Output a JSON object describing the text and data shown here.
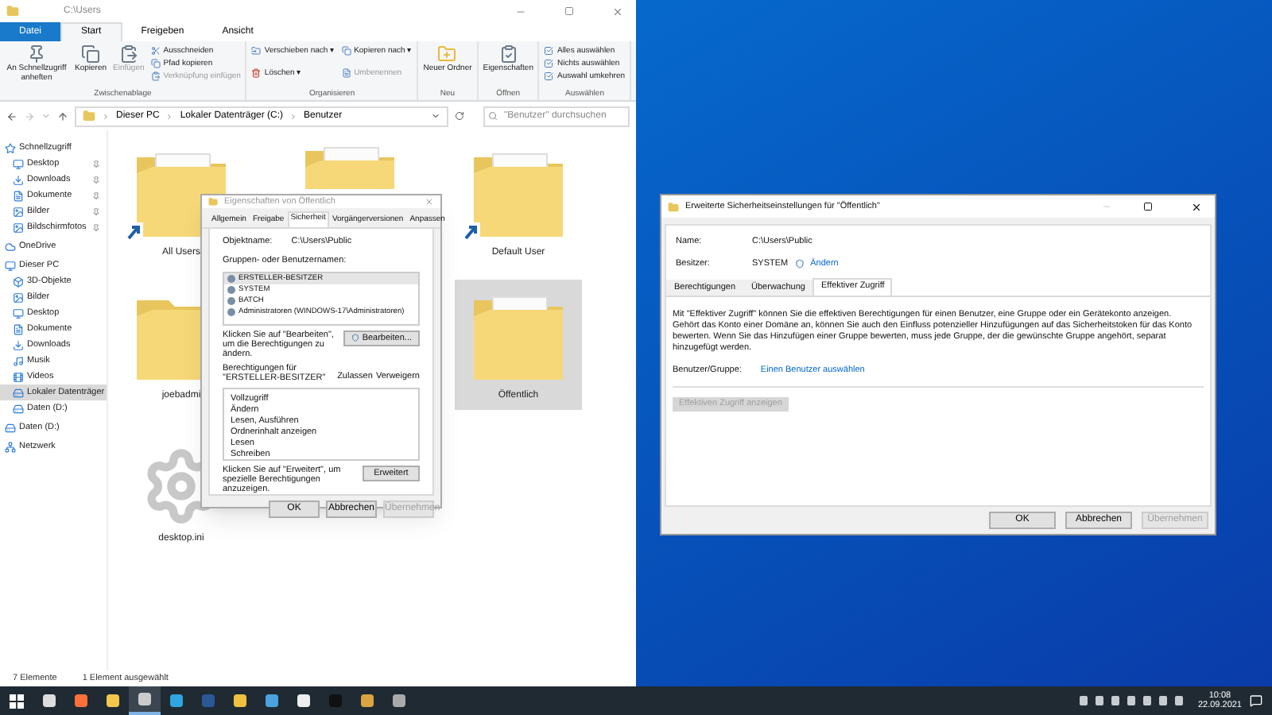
{
  "explorer": {
    "title": "C:\\Users",
    "ribbon_tabs": [
      {
        "label": "Datei",
        "kind": "file"
      },
      {
        "label": "Start",
        "selected": true
      },
      {
        "label": "Freigeben",
        "selected": false
      },
      {
        "label": "Ansicht",
        "selected": false
      }
    ],
    "ribbon_groups": [
      {
        "label": "Zwischenablage",
        "large": [
          {
            "label": "An Schnellzugriff anheften",
            "disabled": false
          },
          {
            "label": "Kopieren",
            "disabled": false
          },
          {
            "label": "Einfügen",
            "disabled": true
          }
        ],
        "small": [
          {
            "label": "Ausschneiden",
            "disabled": false
          },
          {
            "label": "Pfad kopieren",
            "disabled": false
          },
          {
            "label": "Verknüpfung einfügen",
            "disabled": true
          }
        ]
      },
      {
        "label": "Organisieren",
        "small": [
          {
            "label": "Verschieben nach ▾",
            "disabled": false
          },
          {
            "label": "Kopieren nach ▾",
            "disabled": false
          },
          {
            "label": "Löschen ▾",
            "disabled": false
          },
          {
            "label": "Umbenennen",
            "disabled": true
          }
        ]
      },
      {
        "label": "Neu",
        "large": [
          {
            "label": "Neuer Ordner",
            "disabled": false
          }
        ]
      },
      {
        "label": "Öffnen",
        "large": [
          {
            "label": "Eigenschaften",
            "disabled": false
          }
        ]
      },
      {
        "label": "Auswählen",
        "small": [
          {
            "label": "Alles auswählen",
            "disabled": false
          },
          {
            "label": "Nichts auswählen",
            "disabled": false
          },
          {
            "label": "Auswahl umkehren",
            "disabled": false
          }
        ]
      }
    ],
    "breadcrumb": [
      "Dieser PC",
      "Lokaler Datenträger (C:)",
      "Benutzer"
    ],
    "search": {
      "placeholder": "\"Benutzer\" durchsuchen"
    },
    "nav": [
      {
        "label": "Schnellzugriff",
        "selected": false,
        "children": [
          {
            "label": "Desktop",
            "selected": false,
            "pinned": true
          },
          {
            "label": "Downloads",
            "selected": false,
            "pinned": true
          },
          {
            "label": "Dokumente",
            "selected": false,
            "pinned": true
          },
          {
            "label": "Bilder",
            "selected": false,
            "pinned": true
          },
          {
            "label": "Bildschirmfotos",
            "selected": false,
            "pinned": true
          }
        ]
      },
      {
        "label": "OneDrive",
        "selected": false
      },
      {
        "label": "Dieser PC",
        "selected": false,
        "children": [
          {
            "label": "3D-Objekte",
            "selected": false
          },
          {
            "label": "Bilder",
            "selected": false
          },
          {
            "label": "Desktop",
            "selected": false
          },
          {
            "label": "Dokumente",
            "selected": false
          },
          {
            "label": "Downloads",
            "selected": false
          },
          {
            "label": "Musik",
            "selected": false
          },
          {
            "label": "Videos",
            "selected": false
          },
          {
            "label": "Lokaler Datenträger",
            "selected": true
          },
          {
            "label": "Daten (D:)",
            "selected": false
          }
        ]
      },
      {
        "label": "Daten (D:)",
        "selected": false
      },
      {
        "label": "Netzwerk",
        "selected": false
      }
    ],
    "file_columns": [
      [
        {
          "label": "All Users",
          "kind": "shortcut",
          "selected": false
        },
        {
          "label": "joebadmi",
          "kind": "folder",
          "selected": false
        },
        {
          "label": "desktop.ini",
          "kind": "settings-file",
          "selected": false
        }
      ],
      [
        {
          "kind": "document-folder",
          "selected": false
        }
      ],
      [
        {
          "label": "Default User",
          "kind": "shortcut",
          "selected": false
        },
        {
          "label": "Öffentlich",
          "kind": "document-folder",
          "selected": true
        }
      ]
    ],
    "status": [
      "7 Elemente",
      "1 Element ausgewählt"
    ]
  },
  "properties": {
    "title": "Eigenschaften von Öffentlich",
    "tabs": [
      {
        "label": "Allgemein",
        "selected": false
      },
      {
        "label": "Freigabe",
        "selected": false
      },
      {
        "label": "Sicherheit",
        "selected": true
      },
      {
        "label": "Vorgängerversionen",
        "selected": false
      },
      {
        "label": "Anpassen",
        "selected": false
      }
    ],
    "object_label": "Objektname:",
    "object_value": "C:\\Users\\Public",
    "groups_label": "Gruppen- oder Benutzernamen:",
    "groups": [
      {
        "label": "ERSTELLER-BESITZER",
        "selected": true
      },
      {
        "label": "SYSTEM",
        "selected": false
      },
      {
        "label": "BATCH",
        "selected": false
      },
      {
        "label": "Administratoren (WINDOWS-17\\Administratoren)",
        "selected": false
      }
    ],
    "edit_hint": "Klicken Sie auf \"Bearbeiten\", um die Berechtigungen zu ändern.",
    "edit_button": "Bearbeiten...",
    "perm_label": "Berechtigungen für \"ERSTELLER-BESITZER\"",
    "perm_columns": [
      "Zulassen",
      "Verweigern"
    ],
    "permissions": [
      "Vollzugriff",
      "Ändern",
      "Lesen, Ausführen",
      "Ordnerinhalt anzeigen",
      "Lesen",
      "Schreiben"
    ],
    "advanced_hint": "Klicken Sie auf \"Erweitert\", um spezielle Berechtigungen anzuzeigen.",
    "advanced_button": "Erweitert",
    "buttons": [
      {
        "label": "OK",
        "disabled": false
      },
      {
        "label": "Abbrechen",
        "disabled": false
      },
      {
        "label": "Übernehmen",
        "disabled": true
      }
    ]
  },
  "advanced": {
    "title": "Erweiterte Sicherheitseinstellungen für \"Öffentlich\"",
    "name_label": "Name:",
    "name_value": "C:\\Users\\Public",
    "owner_label": "Besitzer:",
    "owner_value": "SYSTEM",
    "owner_link": "Ändern",
    "tabs": [
      {
        "label": "Berechtigungen",
        "selected": false
      },
      {
        "label": "Überwachung",
        "selected": false
      },
      {
        "label": "Effektiver Zugriff",
        "selected": true
      }
    ],
    "description": "Mit \"Effektiver Zugriff\" können Sie die effektiven Berechtigungen für einen Benutzer, eine Gruppe oder ein Gerätekonto anzeigen. Gehört das Konto einer Domäne an, können Sie auch den Einfluss potenzieller Hinzufügungen auf das Sicherheitstoken für das Konto bewerten. Wenn Sie das Hinzufügen einer Gruppe bewerten, muss jede Gruppe, der die gewünschte Gruppe angehört, separat hinzugefügt werden.",
    "user_label": "Benutzer/Gruppe:",
    "user_link": "Einen Benutzer auswählen",
    "show_button": {
      "label": "Effektiven Zugriff anzeigen",
      "disabled": true
    },
    "buttons": [
      {
        "label": "OK",
        "disabled": false
      },
      {
        "label": "Abbrechen",
        "disabled": false
      },
      {
        "label": "Übernehmen",
        "disabled": true
      }
    ]
  },
  "taskbar": {
    "apps": [
      {
        "active": false
      },
      {
        "active": false
      },
      {
        "active": false
      },
      {
        "active": true
      },
      {
        "active": false
      },
      {
        "active": false
      },
      {
        "active": false
      },
      {
        "active": false
      },
      {
        "active": false
      },
      {
        "active": false
      },
      {
        "active": false
      },
      {
        "active": false
      }
    ],
    "time": "10:08",
    "date": "22.09.2021"
  }
}
